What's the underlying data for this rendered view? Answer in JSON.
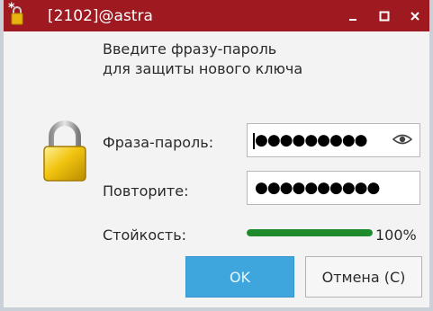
{
  "window": {
    "title": "[2102]@astra",
    "modified_marker": "*",
    "accent_color": "#9e1a20"
  },
  "dialog": {
    "prompt_line1": "Введите фразу-пароль",
    "prompt_line2": "для защиты нового ключа",
    "passphrase_label": "Фраза-пароль:",
    "passphrase_value": "●●●●●●●●●",
    "repeat_label": "Повторите:",
    "repeat_value": "●●●●●●●●●●",
    "strength_label": "Стойкость:",
    "strength_percent": 100,
    "strength_text": "100%",
    "strength_color": "#1f8a29",
    "ok_label": "OK",
    "cancel_label": "Отмена (C)"
  }
}
